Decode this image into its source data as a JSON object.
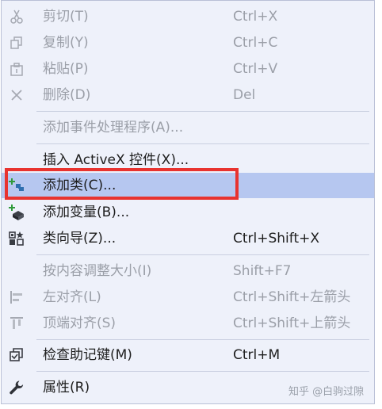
{
  "menu": {
    "items": [
      {
        "label": "剪切(T)",
        "shortcut": "Ctrl+X",
        "icon": "scissors-icon",
        "enabled": false
      },
      {
        "label": "复制(Y)",
        "shortcut": "Ctrl+C",
        "icon": "copy-icon",
        "enabled": false
      },
      {
        "label": "粘贴(P)",
        "shortcut": "Ctrl+V",
        "icon": "paste-icon",
        "enabled": false
      },
      {
        "label": "删除(D)",
        "shortcut": "Del",
        "icon": "delete-icon",
        "enabled": false
      },
      {
        "label": "添加事件处理程序(A)...",
        "shortcut": "",
        "icon": "",
        "enabled": false
      },
      {
        "label": "插入 ActiveX 控件(X)...",
        "shortcut": "",
        "icon": "",
        "enabled": true
      },
      {
        "label": "添加类(C)...",
        "shortcut": "",
        "icon": "add-class-icon",
        "enabled": true,
        "selected": true
      },
      {
        "label": "添加变量(B)...",
        "shortcut": "",
        "icon": "add-variable-icon",
        "enabled": true
      },
      {
        "label": "类向导(Z)...",
        "shortcut": "Ctrl+Shift+X",
        "icon": "class-wizard-icon",
        "enabled": true
      },
      {
        "label": "按内容调整大小(I)",
        "shortcut": "Shift+F7",
        "icon": "",
        "enabled": false
      },
      {
        "label": "左对齐(L)",
        "shortcut": "Ctrl+Shift+左箭头",
        "icon": "align-left-icon",
        "enabled": false
      },
      {
        "label": "顶端对齐(S)",
        "shortcut": "Ctrl+Shift+上箭头",
        "icon": "align-top-icon",
        "enabled": false
      },
      {
        "label": "检查助记键(M)",
        "shortcut": "Ctrl+M",
        "icon": "check-mnemonics-icon",
        "enabled": true
      },
      {
        "label": "属性(R)",
        "shortcut": "",
        "icon": "wrench-icon",
        "enabled": true
      }
    ]
  },
  "watermark": "知乎 @白驹过隙",
  "colors": {
    "menu_bg": "#eef1fa",
    "selected_bg": "#b6c7f0",
    "highlight_border": "#e8332f",
    "disabled_text": "#9b9fa8"
  }
}
